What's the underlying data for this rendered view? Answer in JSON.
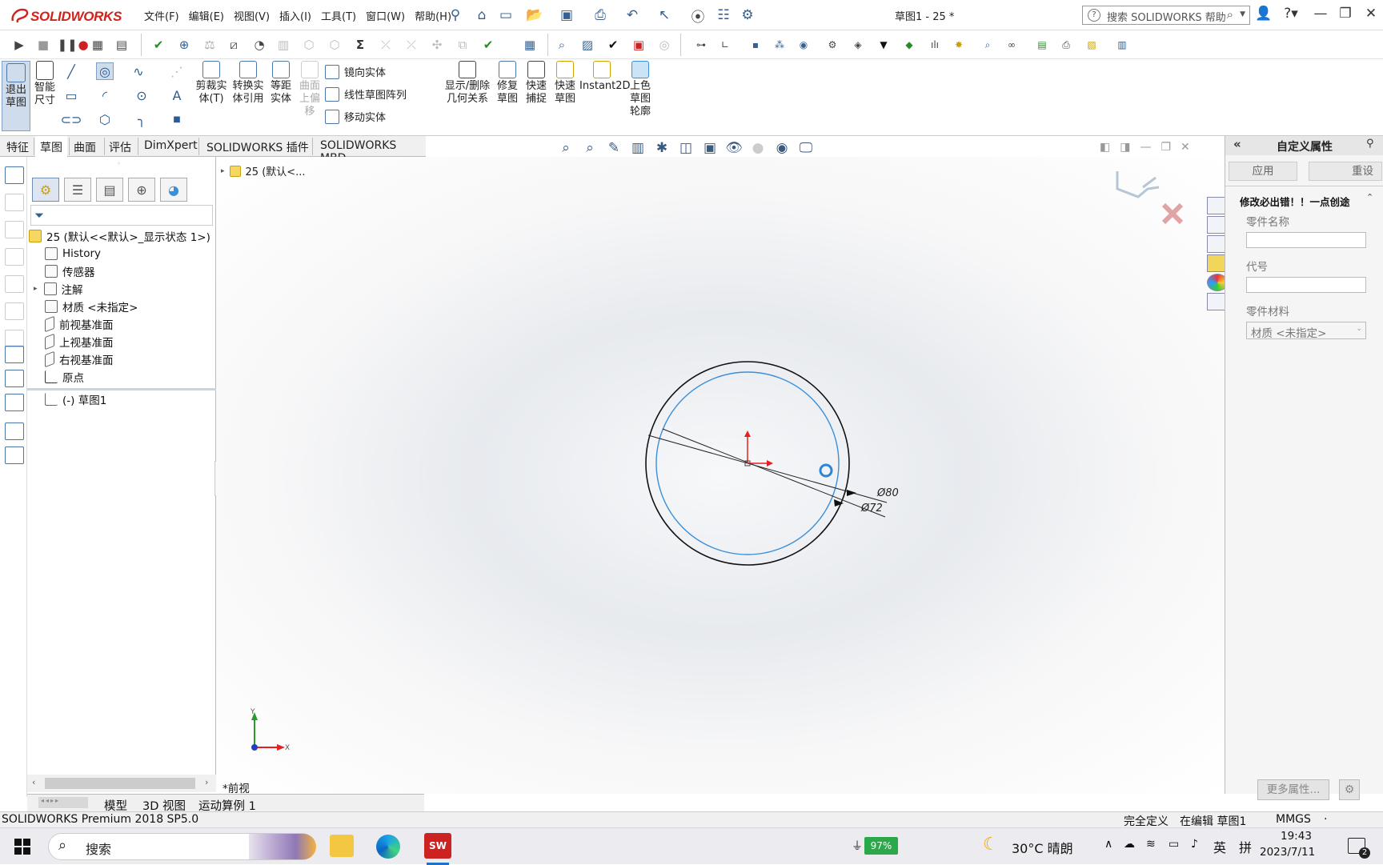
{
  "app": {
    "brand": "SOLIDWORKS",
    "doc_title": "草图1 - 25 *",
    "search_placeholder": "搜索 SOLIDWORKS 帮助"
  },
  "menus": [
    "文件(F)",
    "编辑(E)",
    "视图(V)",
    "插入(I)",
    "工具(T)",
    "窗口(W)",
    "帮助(H)"
  ],
  "ribbon": {
    "exit_sketch": [
      "退出",
      "草图"
    ],
    "smart_dim": [
      "智能",
      "尺寸"
    ],
    "trim": [
      "剪裁实",
      "体(T)"
    ],
    "convert": [
      "转换实",
      "体引用"
    ],
    "offset": [
      "等距",
      "实体"
    ],
    "surface_offset": [
      "曲面",
      "上偏",
      "移"
    ],
    "mirror": "镜向实体",
    "linear_pattern": "线性草图阵列",
    "move": "移动实体",
    "display_relations": [
      "显示/删除",
      "几何关系"
    ],
    "repair": [
      "修复",
      "草图"
    ],
    "quick_snap": [
      "快速",
      "捕捉"
    ],
    "rapid_sketch": [
      "快速",
      "草图"
    ],
    "instant2d": "Instant2D",
    "shaded_sketch": [
      "上色",
      "草图",
      "轮廓"
    ]
  },
  "cmd_tabs": [
    "特征",
    "草图",
    "曲面",
    "评估",
    "DimXpert",
    "SOLIDWORKS 插件",
    "SOLIDWORKS MBD"
  ],
  "tree": {
    "breadcrumb": "25 (默认<...",
    "root": "25 (默认<<默认>_显示状态 1>)",
    "items": [
      "History",
      "传感器",
      "注解",
      "材质 <未指定>",
      "前视基准面",
      "上视基准面",
      "右视基准面",
      "原点",
      "(-) 草图1"
    ]
  },
  "viewport": {
    "dim_outer": "Ø80",
    "dim_inner": "Ø72",
    "view_name": "*前视",
    "triad_x": "X",
    "triad_y": "Y"
  },
  "custom_props": {
    "title": "自定义属性",
    "apply": "应用",
    "reset": "重设",
    "warning": "修改必出错！！一点创途",
    "part_name_label": "零件名称",
    "code_label": "代号",
    "material_label": "零件材料",
    "material_value": "材质 <未指定>",
    "more": "更多属性..."
  },
  "bottom_tabs": [
    "模型",
    "3D 视图",
    "运动算例 1"
  ],
  "status": {
    "product": "SOLIDWORKS Premium 2018 SP5.0",
    "defined": "完全定义",
    "editing": "在编辑 草图1",
    "units": "MMGS",
    "unit_sep": "·"
  },
  "taskbar": {
    "search": "搜索",
    "battery": "97%",
    "weather": "30°C  晴朗",
    "ime_lang": "英",
    "ime_mode": "拼",
    "time": "19:43",
    "date": "2023/7/11",
    "notif": "2"
  },
  "colors": {
    "brand_red": "#d0231b",
    "sketch_blue": "#3a8fd8",
    "accent_blue": "#2b5c93"
  }
}
